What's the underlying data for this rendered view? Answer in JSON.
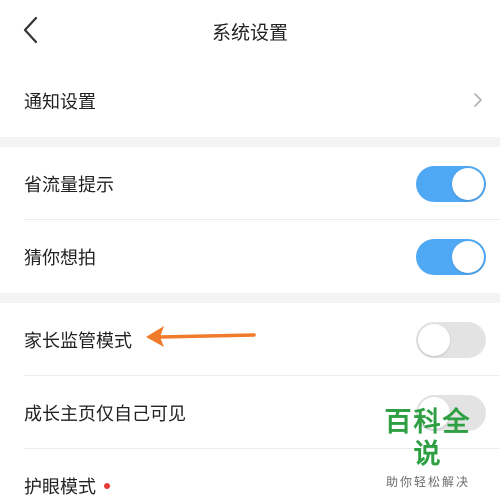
{
  "header": {
    "title": "系统设置",
    "back_icon": "chevron-left-icon"
  },
  "notify": {
    "label": "通知设置",
    "chevron_icon": "chevron-right-icon"
  },
  "data_saver": {
    "label": "省流量提示",
    "enabled": true
  },
  "guess_shoot": {
    "label": "猜你想拍",
    "enabled": true
  },
  "parental": {
    "label": "家长监管模式",
    "enabled": false
  },
  "private_home": {
    "label": "成长主页仅自己可见",
    "enabled": false
  },
  "eye_care": {
    "label": "护眼模式",
    "badge_color": "#e53935"
  },
  "annotation": {
    "arrow_color": "#f07b2a"
  },
  "watermark": {
    "main": "百科全说",
    "sub": "助你轻松解决"
  },
  "colors": {
    "toggle_on": "#4fa8f4",
    "toggle_off": "#e3e3e3",
    "section_gap": "#f4f4f4"
  }
}
